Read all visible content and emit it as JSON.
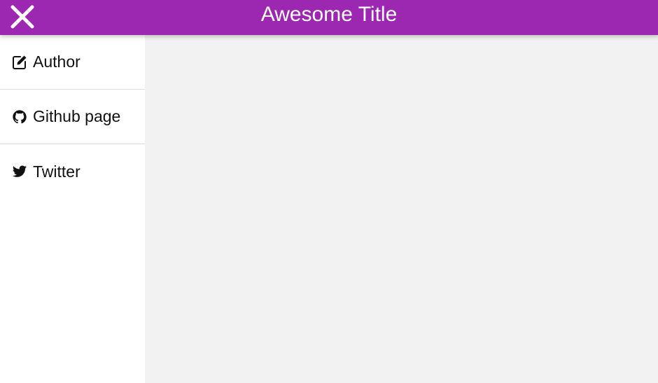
{
  "header": {
    "title": "Awesome Title",
    "background_color": "#9c27b0",
    "close_icon": "close-icon"
  },
  "sidebar": {
    "items": [
      {
        "label": "Author",
        "icon": "edit-icon"
      },
      {
        "label": "Github page",
        "icon": "github-icon"
      },
      {
        "label": "Twitter",
        "icon": "twitter-icon"
      }
    ]
  }
}
